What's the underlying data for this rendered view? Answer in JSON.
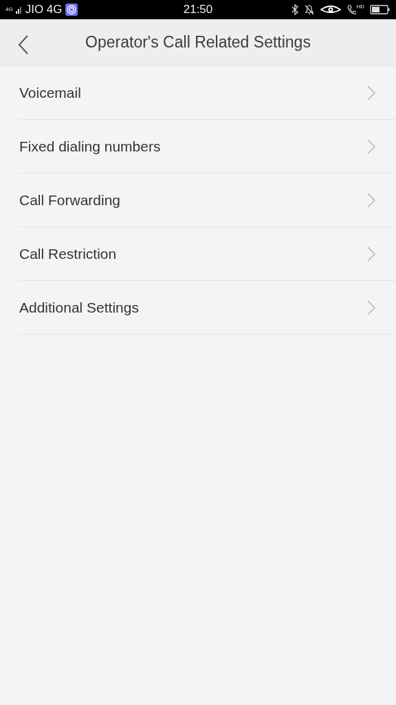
{
  "status_bar": {
    "network_type": "4G",
    "carrier": "JIO 4G",
    "time": "21:50",
    "call_badge": "HD"
  },
  "header": {
    "title": "Operator's Call Related Settings"
  },
  "items": [
    {
      "label": "Voicemail"
    },
    {
      "label": "Fixed dialing numbers"
    },
    {
      "label": "Call Forwarding"
    },
    {
      "label": "Call Restriction"
    },
    {
      "label": "Additional Settings"
    }
  ]
}
